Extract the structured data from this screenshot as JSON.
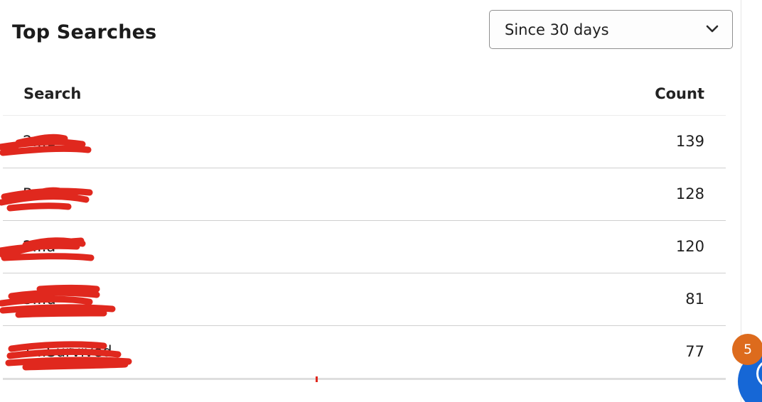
{
  "panel": {
    "title": "Top Searches"
  },
  "filter": {
    "selected": "Since 30 days",
    "chevron_icon": "chevron-down-icon"
  },
  "table": {
    "columns": {
      "search": "Search",
      "count": "Count"
    },
    "rows": [
      {
        "search": "2...1",
        "count": "139"
      },
      {
        "search": "P...a",
        "count": "128"
      },
      {
        "search": "2...a",
        "count": "120"
      },
      {
        "search": "3...d",
        "count": "81"
      },
      {
        "search": "1...Survived",
        "count": "77"
      }
    ]
  },
  "notification": {
    "count": "5"
  },
  "colors": {
    "badge": "#dd6b1d",
    "fab": "#1667d6",
    "redaction": "#e0281e"
  }
}
